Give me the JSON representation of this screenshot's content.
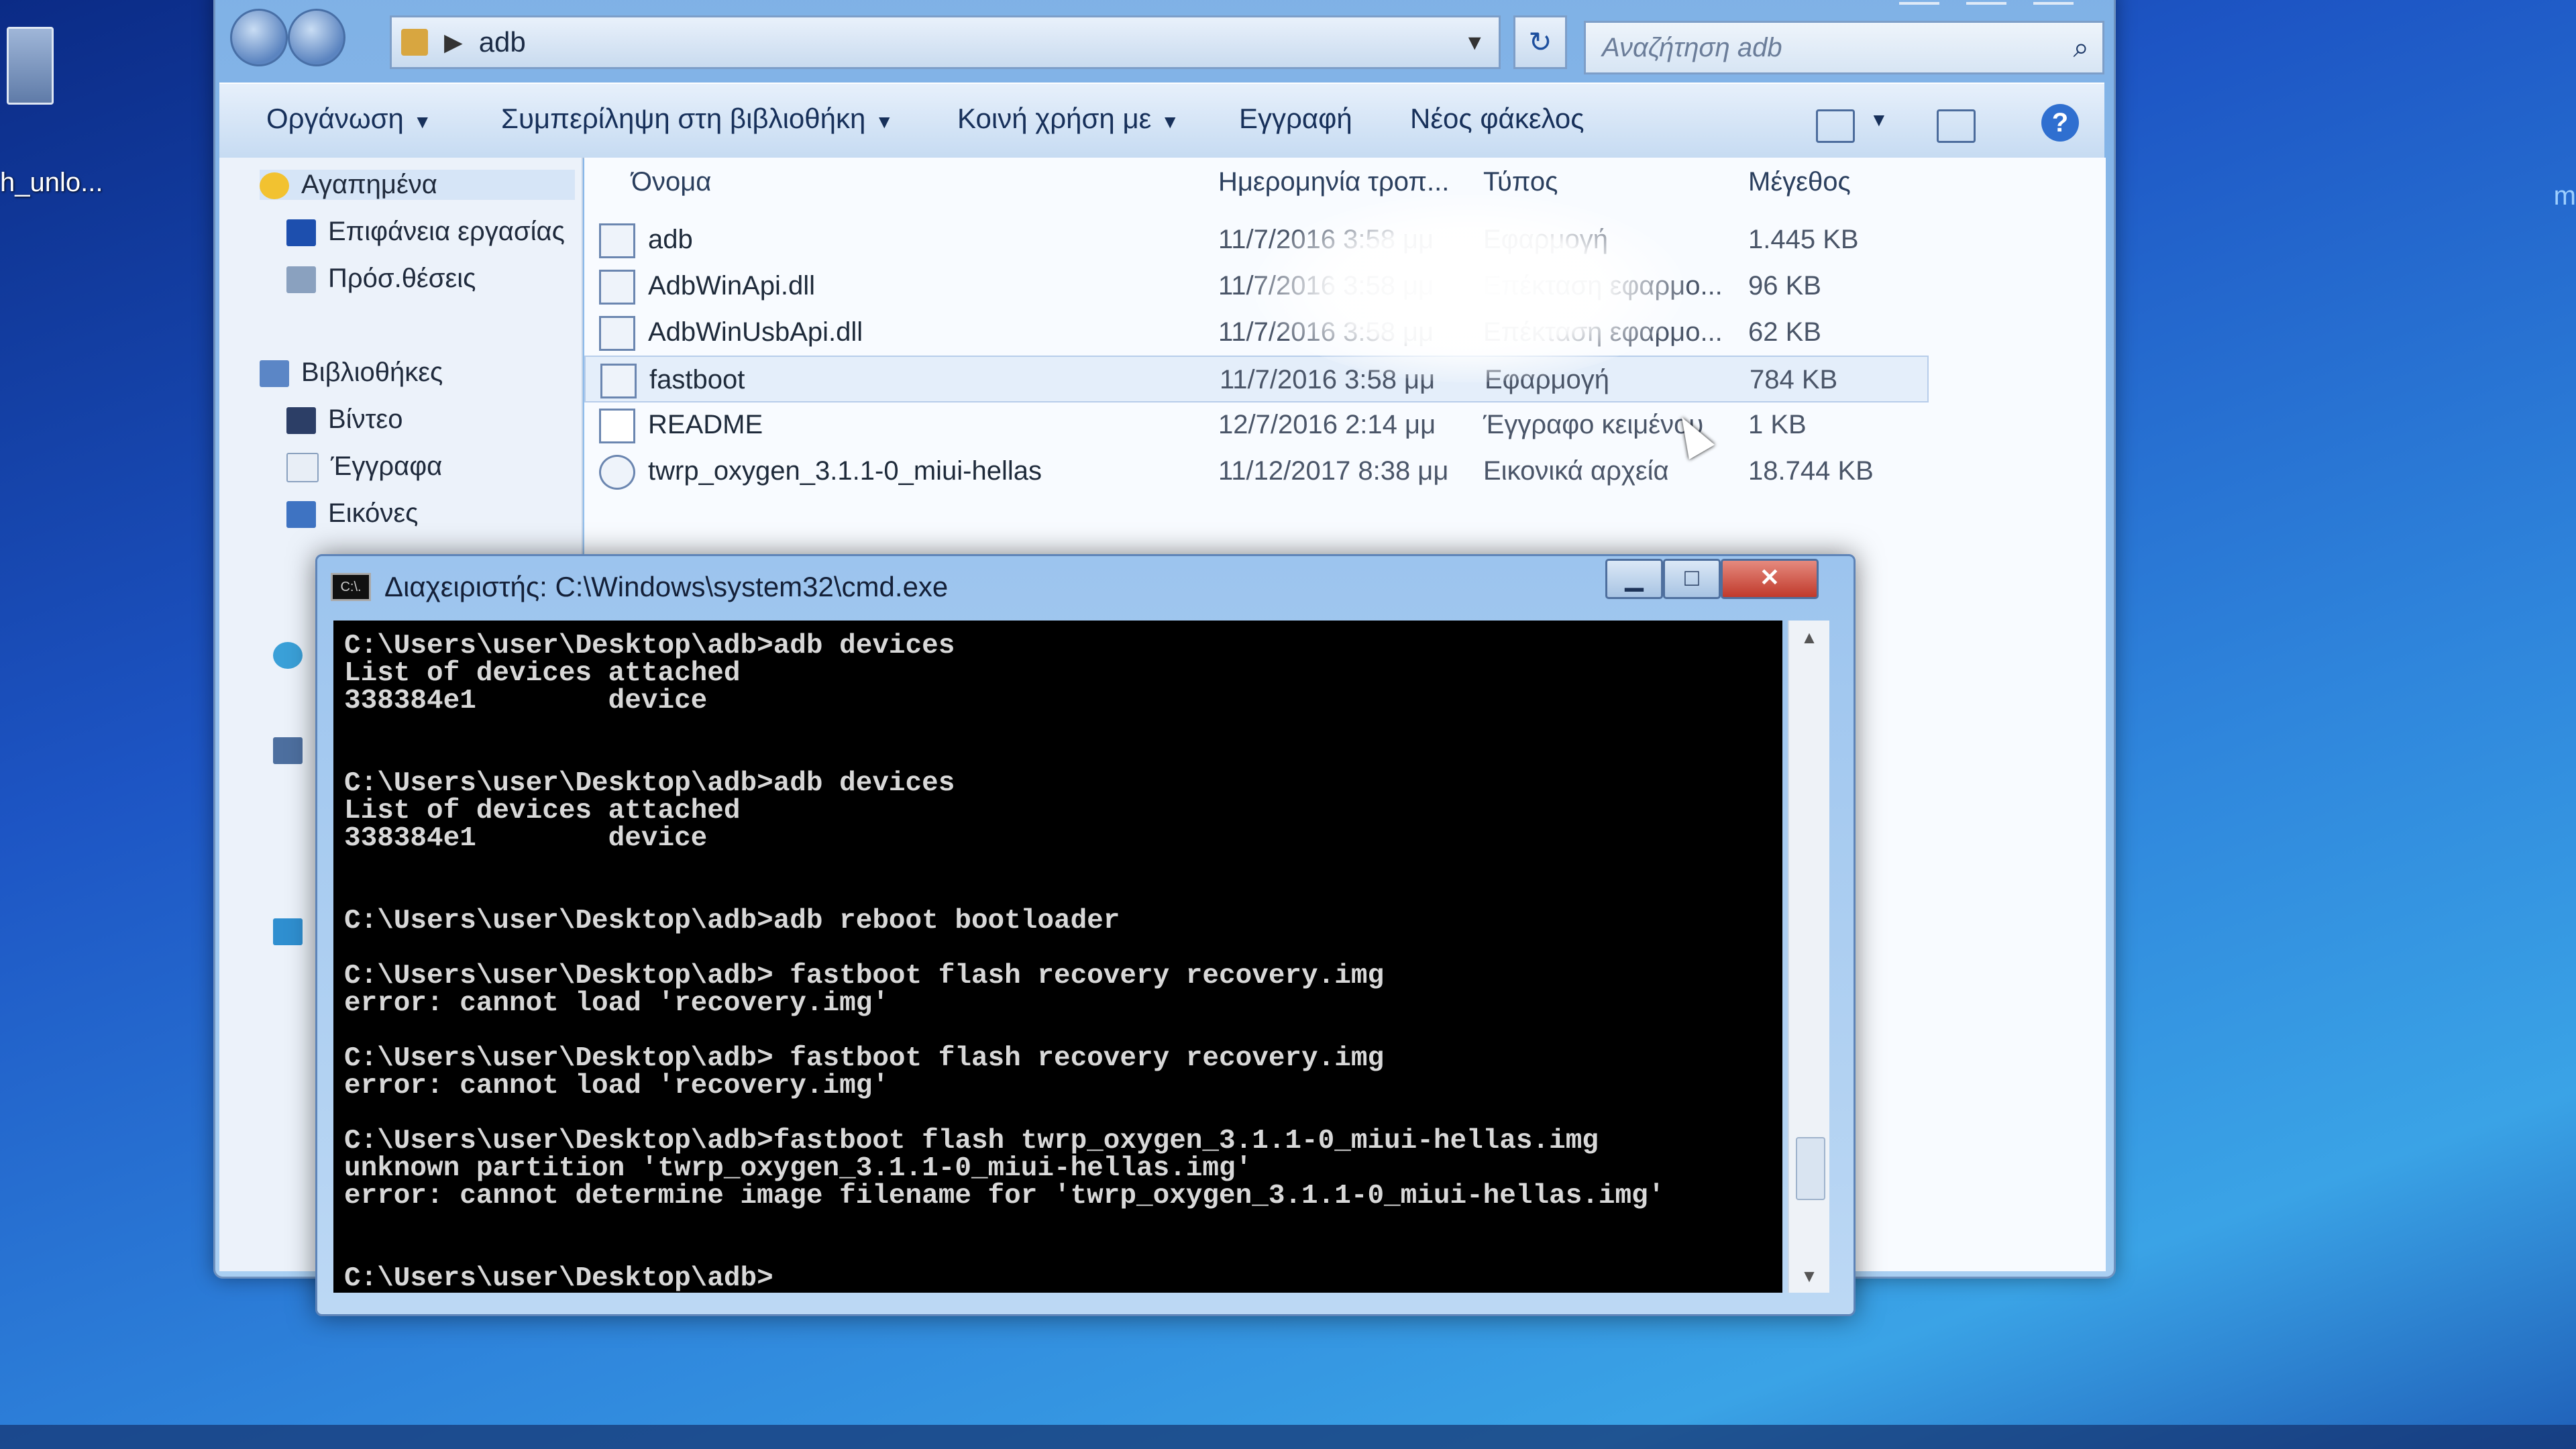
{
  "desktop": {
    "icon_label": "h_unlo...",
    "right_edge_text": "m"
  },
  "explorer": {
    "address": {
      "path": "adb"
    },
    "search_placeholder": "Αναζήτηση adb",
    "commands": {
      "organize": "Οργάνωση",
      "include_in_library": "Συμπερίληψη στη βιβλιοθήκη",
      "share_with": "Κοινή χρήση με",
      "burn": "Εγγραφή",
      "new_folder": "Νέος φάκελος"
    },
    "nav": {
      "favorites": "Αγαπημένα",
      "desktop": "Επιφάνεια εργασίας",
      "recent": "Πρόσ.θέσεις",
      "libraries": "Βιβλιοθήκες",
      "videos": "Βίντεο",
      "documents": "Έγγραφα",
      "pictures": "Εικόνες",
      "homegroup_partial": "Ο",
      "computer_partial": "Υ",
      "network_partial": "Δ"
    },
    "columns": {
      "name": "Όνομα",
      "date": "Ημερομηνία τροπ...",
      "type": "Τύπος",
      "size": "Μέγεθος"
    },
    "files": [
      {
        "name": "adb",
        "date": "11/7/2016 3:58 μμ",
        "type": "Εφαρμογή",
        "size": "1.445 KB"
      },
      {
        "name": "AdbWinApi.dll",
        "date": "11/7/2016 3:58 μμ",
        "type": "Επέκταση εφαρμο...",
        "size": "96 KB"
      },
      {
        "name": "AdbWinUsbApi.dll",
        "date": "11/7/2016 3:58 μμ",
        "type": "Επέκταση εφαρμο...",
        "size": "62 KB"
      },
      {
        "name": "fastboot",
        "date": "11/7/2016 3:58 μμ",
        "type": "Εφαρμογή",
        "size": "784 KB"
      },
      {
        "name": "README",
        "date": "12/7/2016 2:14 μμ",
        "type": "Έγγραφο κειμένου",
        "size": "1 KB"
      },
      {
        "name": "twrp_oxygen_3.1.1-0_miui-hellas",
        "date": "11/12/2017 8:38 μμ",
        "type": "Εικονικά αρχεία",
        "size": "18.744 KB"
      }
    ]
  },
  "cmd": {
    "title": "Διαχειριστής: C:\\Windows\\system32\\cmd.exe",
    "icon_text": "C:\\.",
    "lines": [
      "C:\\Users\\user\\Desktop\\adb>adb devices",
      "List of devices attached",
      "338384e1        device",
      "",
      "",
      "C:\\Users\\user\\Desktop\\adb>adb devices",
      "List of devices attached",
      "338384e1        device",
      "",
      "",
      "C:\\Users\\user\\Desktop\\adb>adb reboot bootloader",
      "",
      "C:\\Users\\user\\Desktop\\adb> fastboot flash recovery recovery.img",
      "error: cannot load 'recovery.img'",
      "",
      "C:\\Users\\user\\Desktop\\adb> fastboot flash recovery recovery.img",
      "error: cannot load 'recovery.img'",
      "",
      "C:\\Users\\user\\Desktop\\adb>fastboot flash twrp_oxygen_3.1.1-0_miui-hellas.img",
      "unknown partition 'twrp_oxygen_3.1.1-0_miui-hellas.img'",
      "error: cannot determine image filename for 'twrp_oxygen_3.1.1-0_miui-hellas.img'",
      "",
      "",
      "C:\\Users\\user\\Desktop\\adb>"
    ]
  }
}
